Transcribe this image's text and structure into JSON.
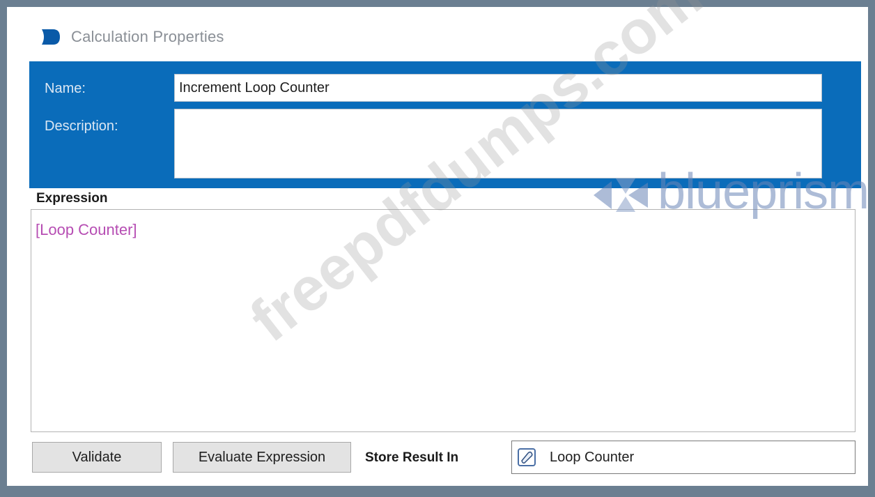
{
  "window": {
    "title": "Calculation Properties"
  },
  "form": {
    "name_label": "Name:",
    "name_value": "Increment Loop Counter",
    "description_label": "Description:",
    "description_value": ""
  },
  "expression": {
    "label": "Expression",
    "value": "[Loop Counter]"
  },
  "buttons": {
    "validate": "Validate",
    "evaluate": "Evaluate Expression"
  },
  "store": {
    "label": "Store Result In",
    "value": "Loop Counter"
  },
  "overlays": {
    "brand": "blueprism",
    "watermark": "freepdfdumps.com"
  },
  "colors": {
    "header_blue": "#0a6cba",
    "expression_text": "#b64db3"
  },
  "icons": {
    "app": "blueprism-logo-icon",
    "store": "data-item-icon",
    "scroll_up": "chevron-up-icon",
    "scroll_down": "chevron-down-icon"
  }
}
